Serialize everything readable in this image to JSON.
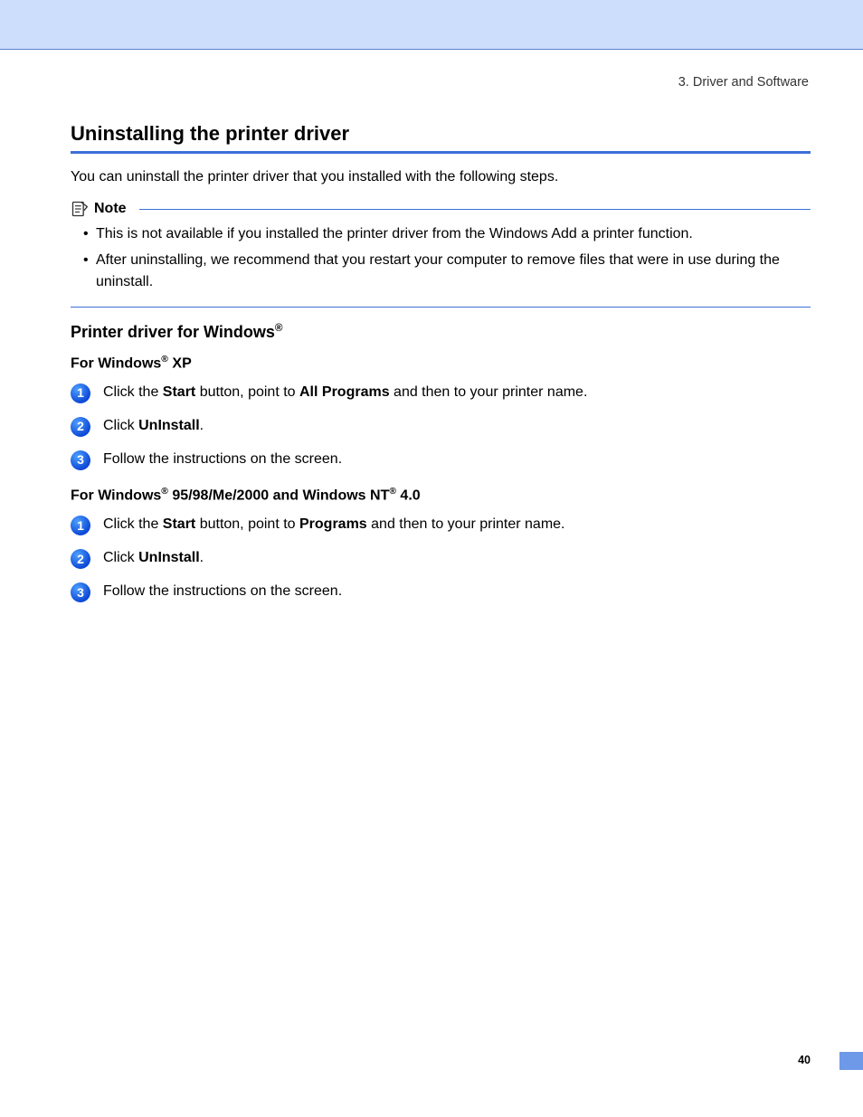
{
  "chapter": "3. Driver and Software",
  "title": "Uninstalling the printer driver",
  "intro": "You can uninstall the printer driver that you installed with the following steps.",
  "note": {
    "label": "Note",
    "items": [
      "This is not available if you installed the printer driver from the Windows Add a printer function.",
      "After uninstalling, we recommend that you restart your computer to remove files that were in use during the uninstall."
    ]
  },
  "subheading_prefix": "Printer driver for Windows",
  "xp_heading_prefix": "For Windows",
  "xp_heading_suffix": " XP",
  "steps_xp": {
    "s1_a": "Click the ",
    "s1_b": "Start",
    "s1_c": " button, point to ",
    "s1_d": "All Programs",
    "s1_e": " and then to your printer name.",
    "s2_a": "Click ",
    "s2_b": "UnInstall",
    "s2_c": ".",
    "s3": "Follow the instructions on the screen."
  },
  "legacy_heading_prefix": "For Windows",
  "legacy_heading_mid": " 95/98/Me/2000 and Windows NT",
  "legacy_heading_suffix": " 4.0",
  "steps_legacy": {
    "s1_a": "Click the ",
    "s1_b": "Start",
    "s1_c": " button, point to ",
    "s1_d": "Programs",
    "s1_e": " and then to your printer name.",
    "s2_a": "Click ",
    "s2_b": "UnInstall",
    "s2_c": ".",
    "s3": "Follow the instructions on the screen."
  },
  "page_number": "40"
}
